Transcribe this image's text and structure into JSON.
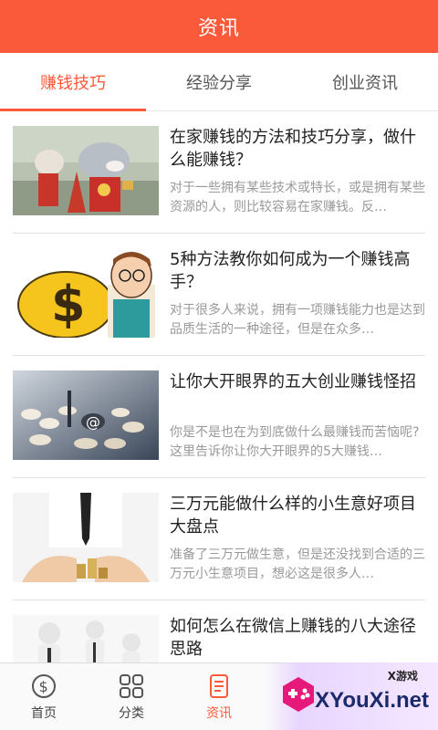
{
  "header": {
    "title": "资讯"
  },
  "tabs": [
    {
      "label": "赚钱技巧",
      "active": true
    },
    {
      "label": "经验分享",
      "active": false
    },
    {
      "label": "创业资讯",
      "active": false
    }
  ],
  "articles": [
    {
      "title": "在家赚钱的方法和技巧分享，做什么能赚钱？",
      "summary": "对于一些拥有某些技术或特长，或是拥有某些资源的人，则比较容易在家赚钱。反…",
      "image": "mascot-wolf-costume"
    },
    {
      "title": "5种方法教你如何成为一个赚钱高手？",
      "summary": "对于很多人来说，拥有一项赚钱能力也是达到品质生活的一种途径，但是在众多…",
      "image": "cartoon-man-money-bag"
    },
    {
      "title": "让你大开眼界的五大创业赚钱怪招",
      "summary": "你是不是也在为到底做什么最赚钱而苦恼呢?这里告诉你让你大开眼界的5大赚钱…",
      "image": "coins-at-sign"
    },
    {
      "title": "三万元能做什么样的小生意好项目大盘点",
      "summary": "准备了三万元做生意，但是还没找到合适的三万元小生意项目，想必这是很多人…",
      "image": "hands-coin-stack"
    },
    {
      "title": "如何怎么在微信上赚钱的八大途径思路",
      "summary": "",
      "image": "business-figures"
    }
  ],
  "bottom_nav": [
    {
      "label": "首页",
      "icon": "dollar-circle-icon",
      "active": false
    },
    {
      "label": "分类",
      "icon": "grid-icon",
      "active": false
    },
    {
      "label": "资讯",
      "icon": "document-icon",
      "active": true
    }
  ],
  "watermark": {
    "small": "X游戏",
    "big": "XYouXi.net"
  },
  "colors": {
    "accent": "#fb5a3a",
    "divider": "#e2e2e2",
    "summary_text": "#999999"
  }
}
